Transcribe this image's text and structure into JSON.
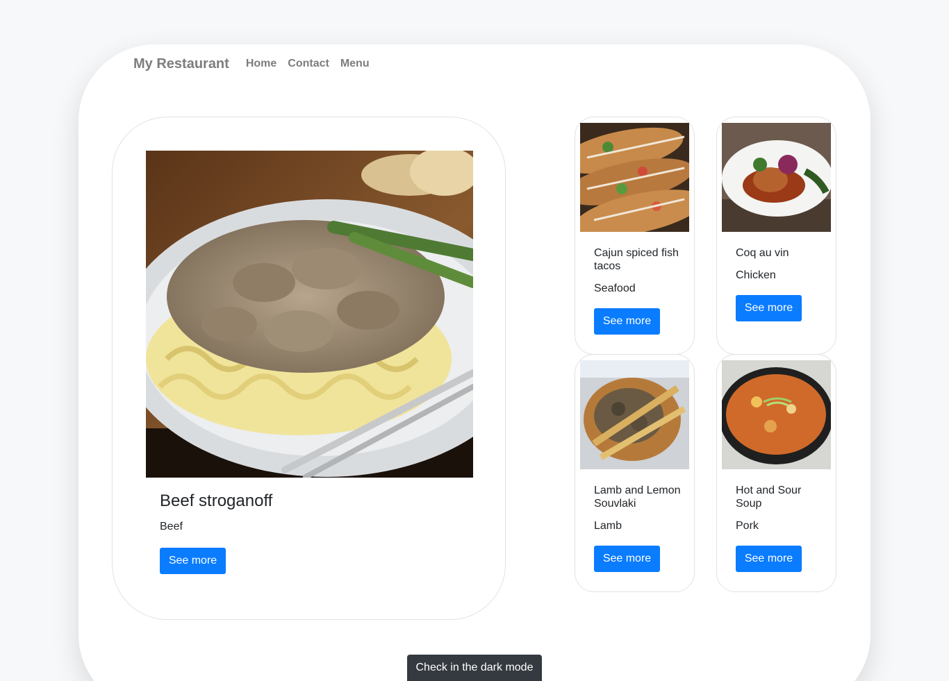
{
  "navbar": {
    "brand": "My Restaurant",
    "links": [
      "Home",
      "Contact",
      "Menu"
    ]
  },
  "featured": {
    "title": "Beef stroganoff",
    "category": "Beef",
    "button": "See more",
    "image": "beef-stroganoff-photo"
  },
  "dishes": [
    {
      "title": "Cajun spiced fish tacos",
      "category": "Seafood",
      "button": "See more",
      "image": "fish-tacos-photo"
    },
    {
      "title": "Coq au vin",
      "category": "Chicken",
      "button": "See more",
      "image": "coq-au-vin-photo"
    },
    {
      "title": "Lamb and Lemon Souvlaki",
      "category": "Lamb",
      "button": "See more",
      "image": "souvlaki-photo"
    },
    {
      "title": "Hot and Sour Soup",
      "category": "Pork",
      "button": "See more",
      "image": "hot-sour-soup-photo"
    }
  ],
  "theme_toggle": {
    "label": "Check in the dark mode"
  },
  "colors": {
    "primary_button": "#0a7cff",
    "nav_text": "#7d7d7d",
    "tooltip_bg": "#343a40",
    "page_bg": "#f7f8fa"
  }
}
